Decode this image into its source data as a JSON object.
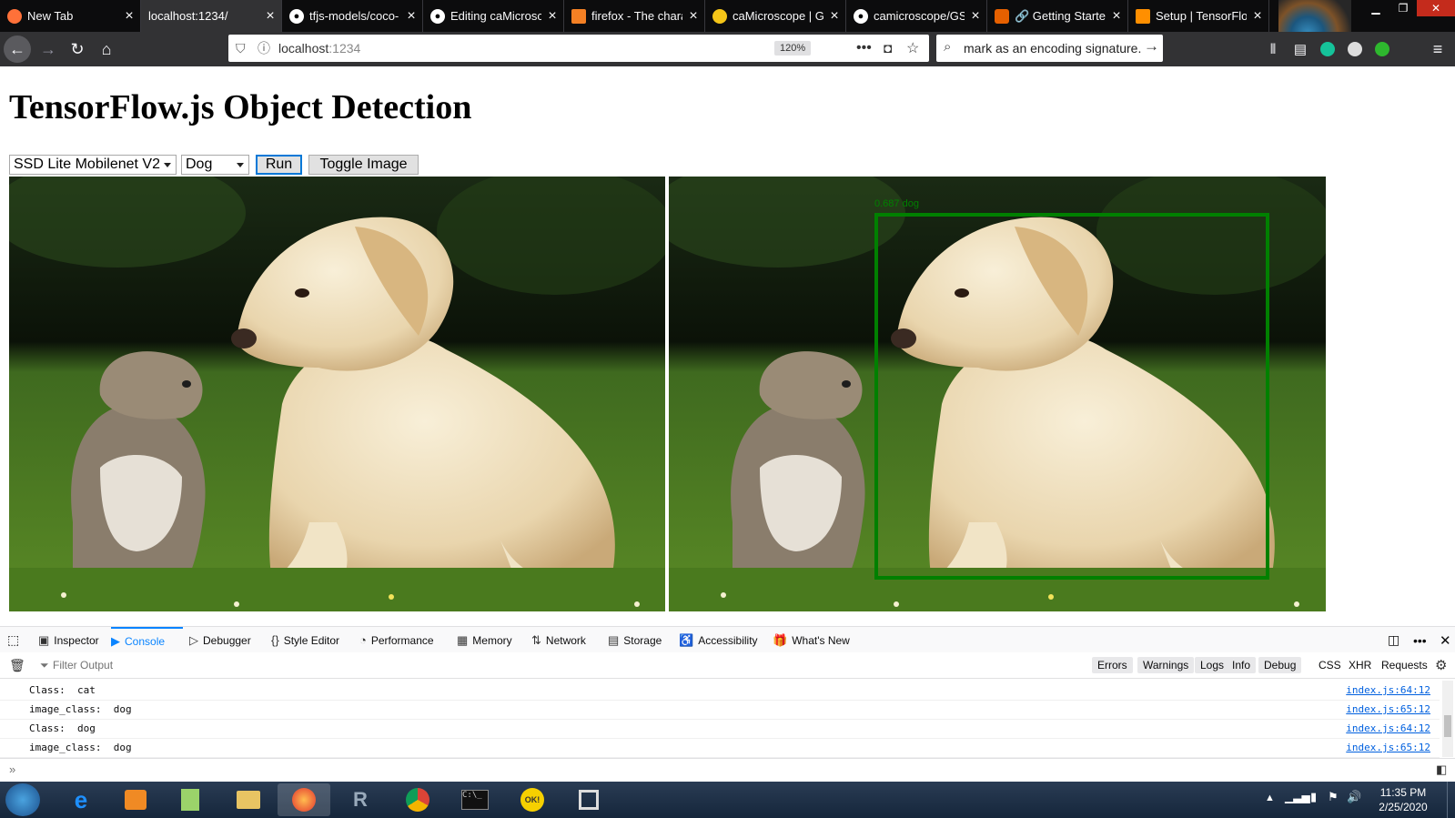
{
  "browser": {
    "tabs": [
      {
        "label": "New Tab",
        "icon": "firefox-icon",
        "active": false
      },
      {
        "label": "localhost:1234/",
        "icon": "none",
        "active": true
      },
      {
        "label": "tfjs-models/coco-",
        "icon": "github-icon",
        "active": false
      },
      {
        "label": "Editing caMicrosc",
        "icon": "github-icon",
        "active": false
      },
      {
        "label": "firefox - The chara",
        "icon": "stackoverflow-icon",
        "active": false
      },
      {
        "label": "caMicroscope | Go",
        "icon": "sun-icon",
        "active": false
      },
      {
        "label": "camicroscope/GS",
        "icon": "github-icon",
        "active": false
      },
      {
        "label": "🔗 Getting Started",
        "icon": "fox-icon",
        "active": false
      },
      {
        "label": "Setup | TensorFlo",
        "icon": "tensorflow-icon",
        "active": false
      }
    ],
    "url_host": "localhost",
    "url_port": ":1234",
    "zoom": "120%",
    "search_text": "mark as an encoding signature."
  },
  "page": {
    "title": "TensorFlow.js Object Detection",
    "model_select": "SSD Lite Mobilenet V2",
    "image_select": "Dog",
    "run_label": "Run",
    "toggle_label": "Toggle Image",
    "detection_label": "0.687 dog"
  },
  "devtools": {
    "tabs": [
      {
        "label": "Inspector",
        "icon": "inspector-icon"
      },
      {
        "label": "Console",
        "icon": "console-icon"
      },
      {
        "label": "Debugger",
        "icon": "debugger-icon"
      },
      {
        "label": "Style Editor",
        "icon": "style-editor-icon"
      },
      {
        "label": "Performance",
        "icon": "performance-icon"
      },
      {
        "label": "Memory",
        "icon": "memory-icon"
      },
      {
        "label": "Network",
        "icon": "network-icon"
      },
      {
        "label": "Storage",
        "icon": "storage-icon"
      },
      {
        "label": "Accessibility",
        "icon": "accessibility-icon"
      },
      {
        "label": "What's New",
        "icon": "whats-new-icon"
      }
    ],
    "filter_placeholder": "Filter Output",
    "filters": [
      "Errors",
      "Warnings",
      "Logs",
      "Info",
      "Debug"
    ],
    "filters_extra": [
      "CSS",
      "XHR",
      "Requests"
    ],
    "logs": [
      {
        "message": "Class:  cat",
        "source": "index.js:64:12"
      },
      {
        "message": "image_class:  dog",
        "source": "index.js:65:12"
      },
      {
        "message": "Class:  dog",
        "source": "index.js:64:12"
      },
      {
        "message": "image_class:  dog",
        "source": "index.js:65:12"
      }
    ]
  },
  "taskbar": {
    "time": "11:35 PM",
    "date": "2/25/2020",
    "ok_badge": "OK!"
  }
}
